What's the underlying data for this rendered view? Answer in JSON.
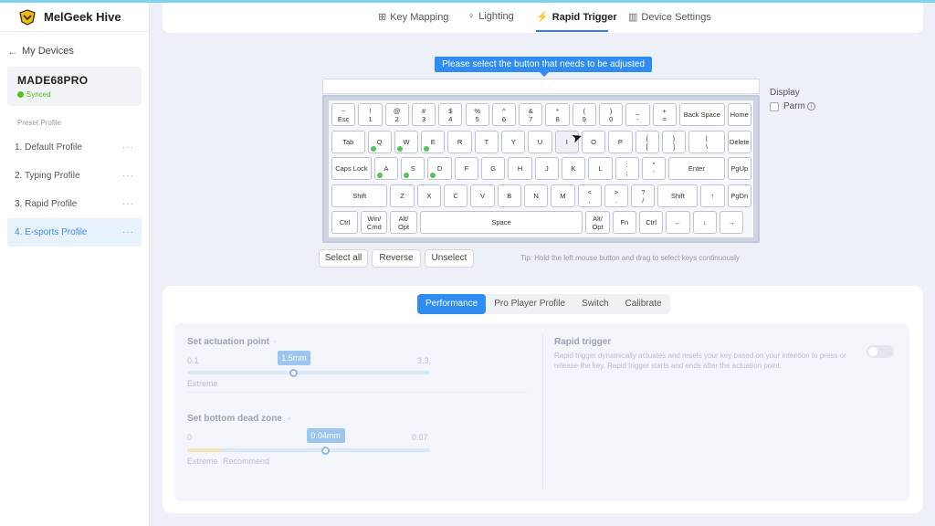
{
  "app": {
    "name": "MelGeek Hive"
  },
  "sidebar": {
    "back_label": "My Devices",
    "device_name": "MADE68PRO",
    "device_status": "Synced",
    "preset_label": "Preset Profile",
    "profiles": [
      {
        "label": "1. Default Profile"
      },
      {
        "label": "2. Typing Profile"
      },
      {
        "label": "3. Rapid Profile"
      },
      {
        "label": "4. E-sports Profile",
        "active": true
      }
    ],
    "more_glyph": "···"
  },
  "tabs": [
    {
      "label": "Key Mapping",
      "icon": "key-mapping-icon"
    },
    {
      "label": "Lighting",
      "icon": "bulb-icon"
    },
    {
      "label": "Rapid Trigger",
      "icon": "lightning-icon",
      "active": true
    },
    {
      "label": "Device Settings",
      "icon": "device-settings-icon"
    }
  ],
  "keyboard": {
    "hint": "Please select the button that needs to be adjusted",
    "rows": [
      [
        {
          "top": "~",
          "bottom": "Esc"
        },
        {
          "top": "!",
          "bottom": "1"
        },
        {
          "top": "@",
          "bottom": "2"
        },
        {
          "top": "#",
          "bottom": "3"
        },
        {
          "top": "$",
          "bottom": "4"
        },
        {
          "top": "%",
          "bottom": "5"
        },
        {
          "top": "^",
          "bottom": "6"
        },
        {
          "top": "&",
          "bottom": "7"
        },
        {
          "top": "*",
          "bottom": "8"
        },
        {
          "top": "(",
          "bottom": "9"
        },
        {
          "top": ")",
          "bottom": "0"
        },
        {
          "top": "_",
          "bottom": "-"
        },
        {
          "top": "+",
          "bottom": "="
        },
        {
          "top": "",
          "bottom": "Back Space"
        },
        {
          "top": "",
          "bottom": "Home"
        }
      ],
      [
        {
          "top": "",
          "bottom": "Tab"
        },
        {
          "top": "",
          "bottom": "Q",
          "marked": true
        },
        {
          "top": "",
          "bottom": "W",
          "marked": true
        },
        {
          "top": "",
          "bottom": "E",
          "marked": true
        },
        {
          "top": "",
          "bottom": "R"
        },
        {
          "top": "",
          "bottom": "T"
        },
        {
          "top": "",
          "bottom": "Y"
        },
        {
          "top": "",
          "bottom": "U"
        },
        {
          "top": "",
          "bottom": "I"
        },
        {
          "top": "",
          "bottom": "O"
        },
        {
          "top": "",
          "bottom": "P"
        },
        {
          "top": "{",
          "bottom": "["
        },
        {
          "top": "}",
          "bottom": "]"
        },
        {
          "top": "|",
          "bottom": "\\"
        },
        {
          "top": "",
          "bottom": "Delete"
        }
      ],
      [
        {
          "top": "",
          "bottom": "Caps Lock"
        },
        {
          "top": "",
          "bottom": "A",
          "marked": true
        },
        {
          "top": "",
          "bottom": "S",
          "marked": true
        },
        {
          "top": "",
          "bottom": "D",
          "marked": true
        },
        {
          "top": "",
          "bottom": "F"
        },
        {
          "top": "",
          "bottom": "G"
        },
        {
          "top": "",
          "bottom": "H"
        },
        {
          "top": "",
          "bottom": "J"
        },
        {
          "top": "",
          "bottom": "K"
        },
        {
          "top": "",
          "bottom": "L"
        },
        {
          "top": ":",
          "bottom": ";"
        },
        {
          "top": "\"",
          "bottom": "'"
        },
        {
          "top": "",
          "bottom": "Enter"
        },
        {
          "top": "",
          "bottom": "PgUp"
        }
      ],
      [
        {
          "top": "",
          "bottom": "Shift"
        },
        {
          "top": "",
          "bottom": "Z"
        },
        {
          "top": "",
          "bottom": "X"
        },
        {
          "top": "",
          "bottom": "C"
        },
        {
          "top": "",
          "bottom": "V"
        },
        {
          "top": "",
          "bottom": "B"
        },
        {
          "top": "",
          "bottom": "N"
        },
        {
          "top": "",
          "bottom": "M"
        },
        {
          "top": "<",
          "bottom": ","
        },
        {
          "top": ">",
          "bottom": "."
        },
        {
          "top": "?",
          "bottom": "/"
        },
        {
          "top": "",
          "bottom": "Shift"
        },
        {
          "top": "",
          "bottom": "↑"
        },
        {
          "top": "",
          "bottom": "PgDn"
        }
      ],
      [
        {
          "top": "",
          "bottom": "Ctrl"
        },
        {
          "top": "Win/",
          "bottom": "Cmd"
        },
        {
          "top": "Alt/",
          "bottom": "Opt"
        },
        {
          "top": "",
          "bottom": "Space"
        },
        {
          "top": "Alt/",
          "bottom": "Opt"
        },
        {
          "top": "",
          "bottom": "Fn"
        },
        {
          "top": "",
          "bottom": "Ctrl"
        },
        {
          "top": "",
          "bottom": "←"
        },
        {
          "top": "",
          "bottom": "↓"
        },
        {
          "top": "",
          "bottom": "→"
        }
      ]
    ]
  },
  "display": {
    "title": "Display",
    "option_label": "Parm"
  },
  "selection_buttons": [
    "Select all",
    "Reverse",
    "Unselect"
  ],
  "tip": "Tip: Hold the left mouse button and drag to select keys continuously",
  "sub_tabs": [
    {
      "label": "Performance",
      "active": true
    },
    {
      "label": "Pro Player Profile"
    },
    {
      "label": "Switch"
    },
    {
      "label": "Calibrate"
    }
  ],
  "actuation": {
    "title": "Set actuation point",
    "min": "0.1",
    "max": "3.3",
    "value": "1.5mm",
    "fraction": 0.44,
    "left_label": "Extreme"
  },
  "dead_zone": {
    "title": "Set bottom dead zone",
    "min": "0",
    "max": "0.07",
    "value": "0.04mm",
    "fraction": 0.57,
    "left_label": "Extreme",
    "mid_label": "Recommend"
  },
  "rapid_trigger": {
    "title": "Rapid trigger",
    "description": "Rapid trigger dynamically actuates and resets your key based on your intention to press or release the key. Rapid trigger starts and ends after the actuation point.",
    "enabled": false
  }
}
